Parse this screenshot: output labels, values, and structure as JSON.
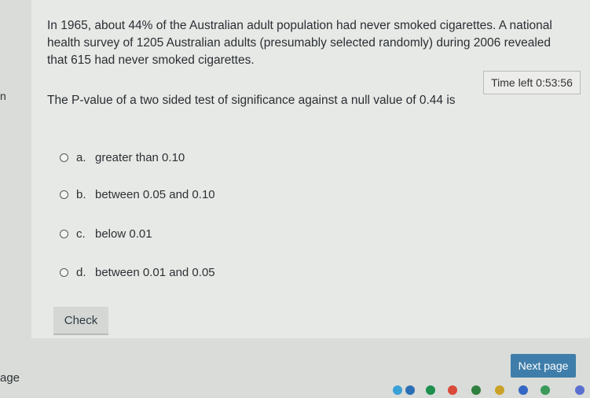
{
  "question": {
    "text": "In 1965, about 44% of the Australian adult population had never smoked cigarettes. A national health survey of 1205 Australian adults (presumably selected randomly) during 2006 revealed that 615 had never smoked cigarettes.",
    "prompt": "The P-value of a two sided test of significance against a null value of 0.44 is"
  },
  "timer": {
    "label": "Time left 0:53:56"
  },
  "edge_glyph": "n",
  "options": [
    {
      "letter": "a.",
      "text": "greater than 0.10"
    },
    {
      "letter": "b.",
      "text": "between 0.05 and 0.10"
    },
    {
      "letter": "c.",
      "text": "below 0.01"
    },
    {
      "letter": "d.",
      "text": "between 0.01 and 0.05"
    }
  ],
  "check_label": "Check",
  "next_label": "Next page",
  "page_label": "age",
  "taskbar": {
    "icons": [
      "app-icon",
      "app-icon",
      "app-icon",
      "chrome-icon",
      "app-icon",
      "chrome-icon",
      "chrome-icon",
      "app-icon",
      "app-icon"
    ],
    "colors": [
      "#3aa0d8",
      "#2c6fb5",
      "#1f8f4e",
      "#d94a3a",
      "#2f7f3f",
      "#c9a227",
      "#3567c4",
      "#3b9a5a",
      "#5a6fd0"
    ]
  },
  "colors": {
    "accent": "#3f7eaa",
    "background": "#e7e9e6"
  }
}
